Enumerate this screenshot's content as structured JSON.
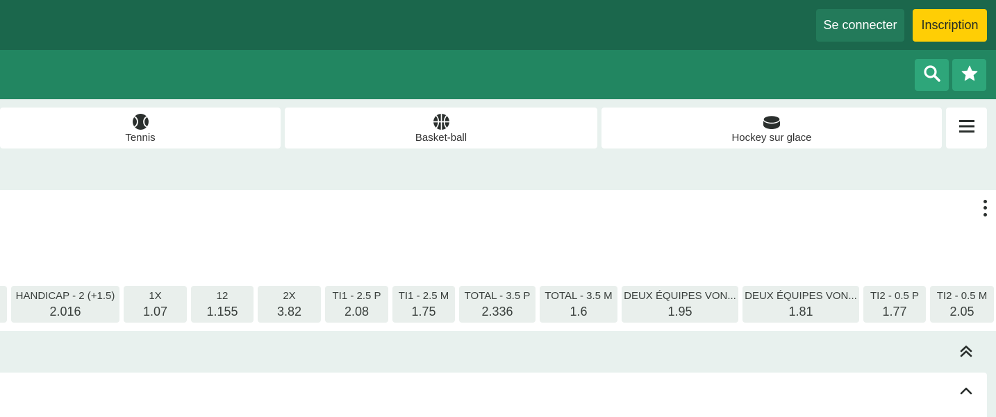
{
  "header": {
    "login_label": "Se connecter",
    "register_label": "Inscription",
    "register_color": "#ffce05"
  },
  "toolbar": {
    "search_icon": "search-icon",
    "favorites_icon": "star-icon"
  },
  "sports": [
    {
      "label": "Tennis",
      "icon": "tennis-ball-icon"
    },
    {
      "label": "Basket-ball",
      "icon": "basketball-icon"
    },
    {
      "label": "Hockey sur glace",
      "icon": "hockey-puck-icon"
    }
  ],
  "odds": [
    {
      "market": "",
      "value": ""
    },
    {
      "market": "HANDICAP - 2 (+1.5)",
      "value": "2.016"
    },
    {
      "market": "1X",
      "value": "1.07"
    },
    {
      "market": "12",
      "value": "1.155"
    },
    {
      "market": "2X",
      "value": "3.82"
    },
    {
      "market": "TI1 - 2.5 P",
      "value": "2.08"
    },
    {
      "market": "TI1 - 2.5 M",
      "value": "1.75"
    },
    {
      "market": "TOTAL - 3.5 P",
      "value": "2.336"
    },
    {
      "market": "TOTAL - 3.5 M",
      "value": "1.6"
    },
    {
      "market": "DEUX ÉQUIPES VON...",
      "value": "1.95"
    },
    {
      "market": "DEUX ÉQUIPES VON...",
      "value": "1.81"
    },
    {
      "market": "TI2 - 0.5 P",
      "value": "1.77"
    },
    {
      "market": "TI2 - 0.5 M",
      "value": "2.05"
    }
  ],
  "colors": {
    "topbar": "#1b674c",
    "secondbar": "#228661",
    "accent_button": "#2ea67a",
    "page_background": "#e8f1ee"
  }
}
